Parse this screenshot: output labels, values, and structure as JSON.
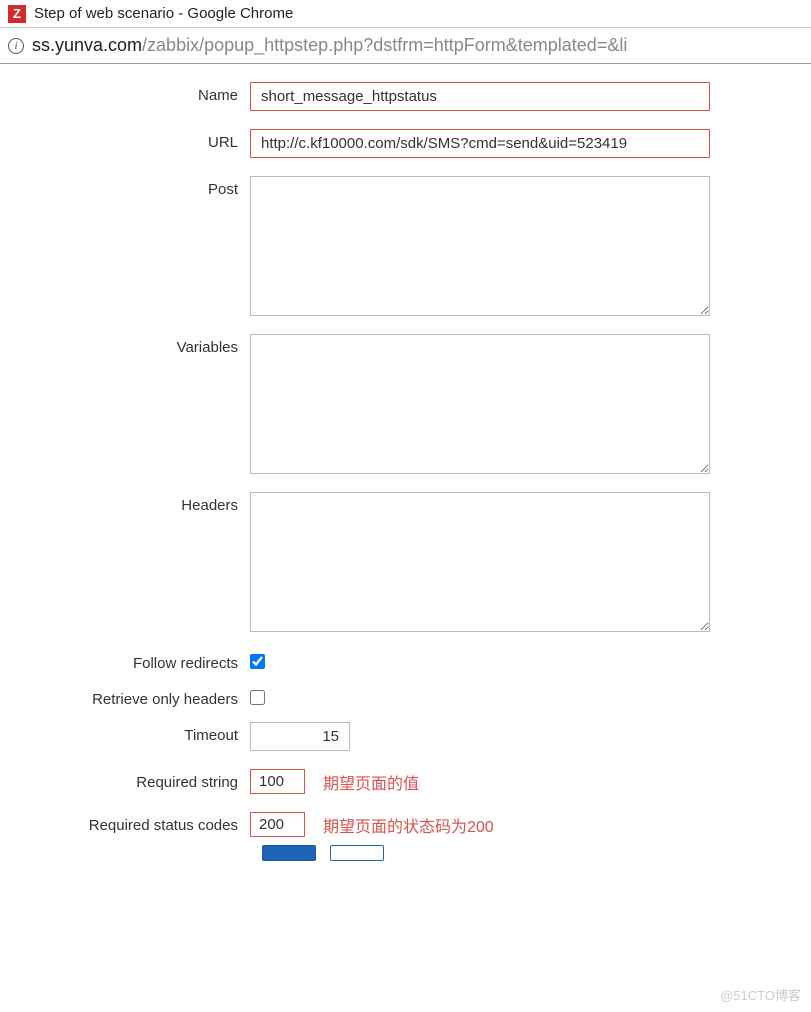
{
  "window": {
    "title": "Step of web scenario - Google Chrome",
    "favicon_letter": "Z"
  },
  "address": {
    "domain": "ss.yunva.com",
    "path": "/zabbix/popup_httpstep.php?dstfrm=httpForm&templated=&li"
  },
  "form": {
    "name_label": "Name",
    "name_value": "short_message_httpstatus",
    "url_label": "URL",
    "url_value": "http://c.kf10000.com/sdk/SMS?cmd=send&uid=523419",
    "post_label": "Post",
    "post_value": "",
    "variables_label": "Variables",
    "variables_value": "",
    "headers_label": "Headers",
    "headers_value": "",
    "follow_redirects_label": "Follow redirects",
    "follow_redirects_checked": true,
    "retrieve_headers_label": "Retrieve only headers",
    "retrieve_headers_checked": false,
    "timeout_label": "Timeout",
    "timeout_value": "15",
    "required_string_label": "Required string",
    "required_string_value": "100",
    "required_status_label": "Required status codes",
    "required_status_value": "200"
  },
  "annotations": {
    "required_string": "期望页面的值",
    "required_status": "期望页面的状态码为200"
  },
  "watermark": "@51CTO博客"
}
